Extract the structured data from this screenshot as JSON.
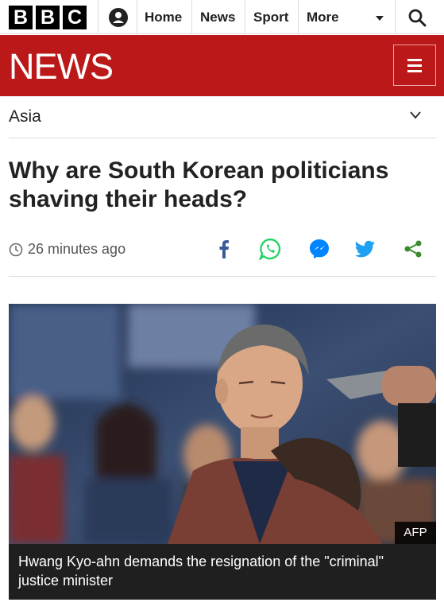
{
  "topbar": {
    "logo_letters": [
      "B",
      "B",
      "C"
    ],
    "nav": [
      "Home",
      "News",
      "Sport",
      "More"
    ],
    "account_icon": "account-icon",
    "search_icon": "search-icon"
  },
  "banner": {
    "title": "NEWS",
    "menu_icon": "hamburger-menu-icon",
    "color": "#bb1919"
  },
  "section": {
    "label": "Asia"
  },
  "article": {
    "headline": "Why are South Korean politicians shaving their heads?",
    "timestamp": "26 minutes ago",
    "share_icons": [
      "facebook-icon",
      "whatsapp-icon",
      "messenger-icon",
      "twitter-icon",
      "share-icon"
    ]
  },
  "image": {
    "credit": "AFP",
    "caption": "Hwang Kyo-ahn demands the resignation of the \"criminal\" justice minister"
  }
}
